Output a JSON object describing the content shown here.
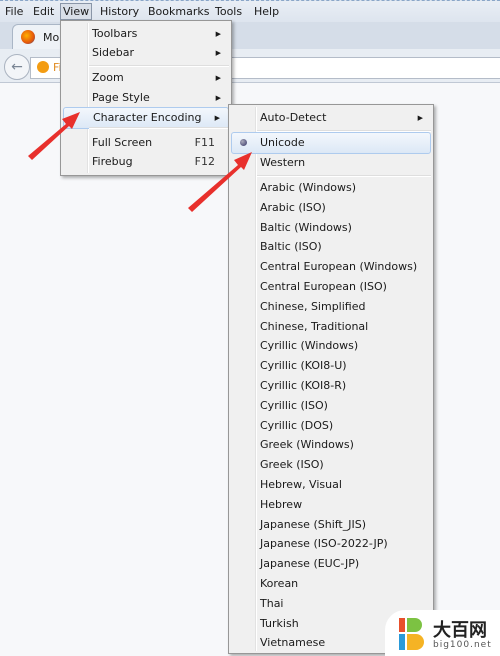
{
  "menubar": [
    "File",
    "Edit",
    "View",
    "History",
    "Bookmarks",
    "Tools",
    "Help"
  ],
  "tab": {
    "title": "Mo"
  },
  "url": {
    "text": "Fi"
  },
  "view_menu": [
    {
      "label": "Toolbars",
      "submenu": true
    },
    {
      "label": "Sidebar",
      "submenu": true
    },
    {
      "label": "Zoom",
      "submenu": true
    },
    {
      "label": "Page Style",
      "submenu": true
    },
    {
      "label": "Character Encoding",
      "submenu": true,
      "highlighted": true
    },
    {
      "label": "Full Screen",
      "shortcut": "F11"
    },
    {
      "label": "Firebug",
      "shortcut": "F12"
    }
  ],
  "encoding_menu": {
    "auto_detect": "Auto-Detect",
    "unicode": "Unicode",
    "western": "Western",
    "selected": "Unicode",
    "items": [
      "Arabic (Windows)",
      "Arabic (ISO)",
      "Baltic (Windows)",
      "Baltic (ISO)",
      "Central European (Windows)",
      "Central European (ISO)",
      "Chinese, Simplified",
      "Chinese, Traditional",
      "Cyrillic (Windows)",
      "Cyrillic (KOI8-U)",
      "Cyrillic (KOI8-R)",
      "Cyrillic (ISO)",
      "Cyrillic (DOS)",
      "Greek (Windows)",
      "Greek (ISO)",
      "Hebrew, Visual",
      "Hebrew",
      "Japanese (Shift_JIS)",
      "Japanese (ISO-2022-JP)",
      "Japanese (EUC-JP)",
      "Korean",
      "Thai",
      "Turkish",
      "Vietnamese"
    ]
  },
  "watermark": {
    "name": "大百网",
    "domain": "big100.net"
  },
  "colors": {
    "arrow": "#e8302c",
    "highlight": "#dce8f6"
  }
}
